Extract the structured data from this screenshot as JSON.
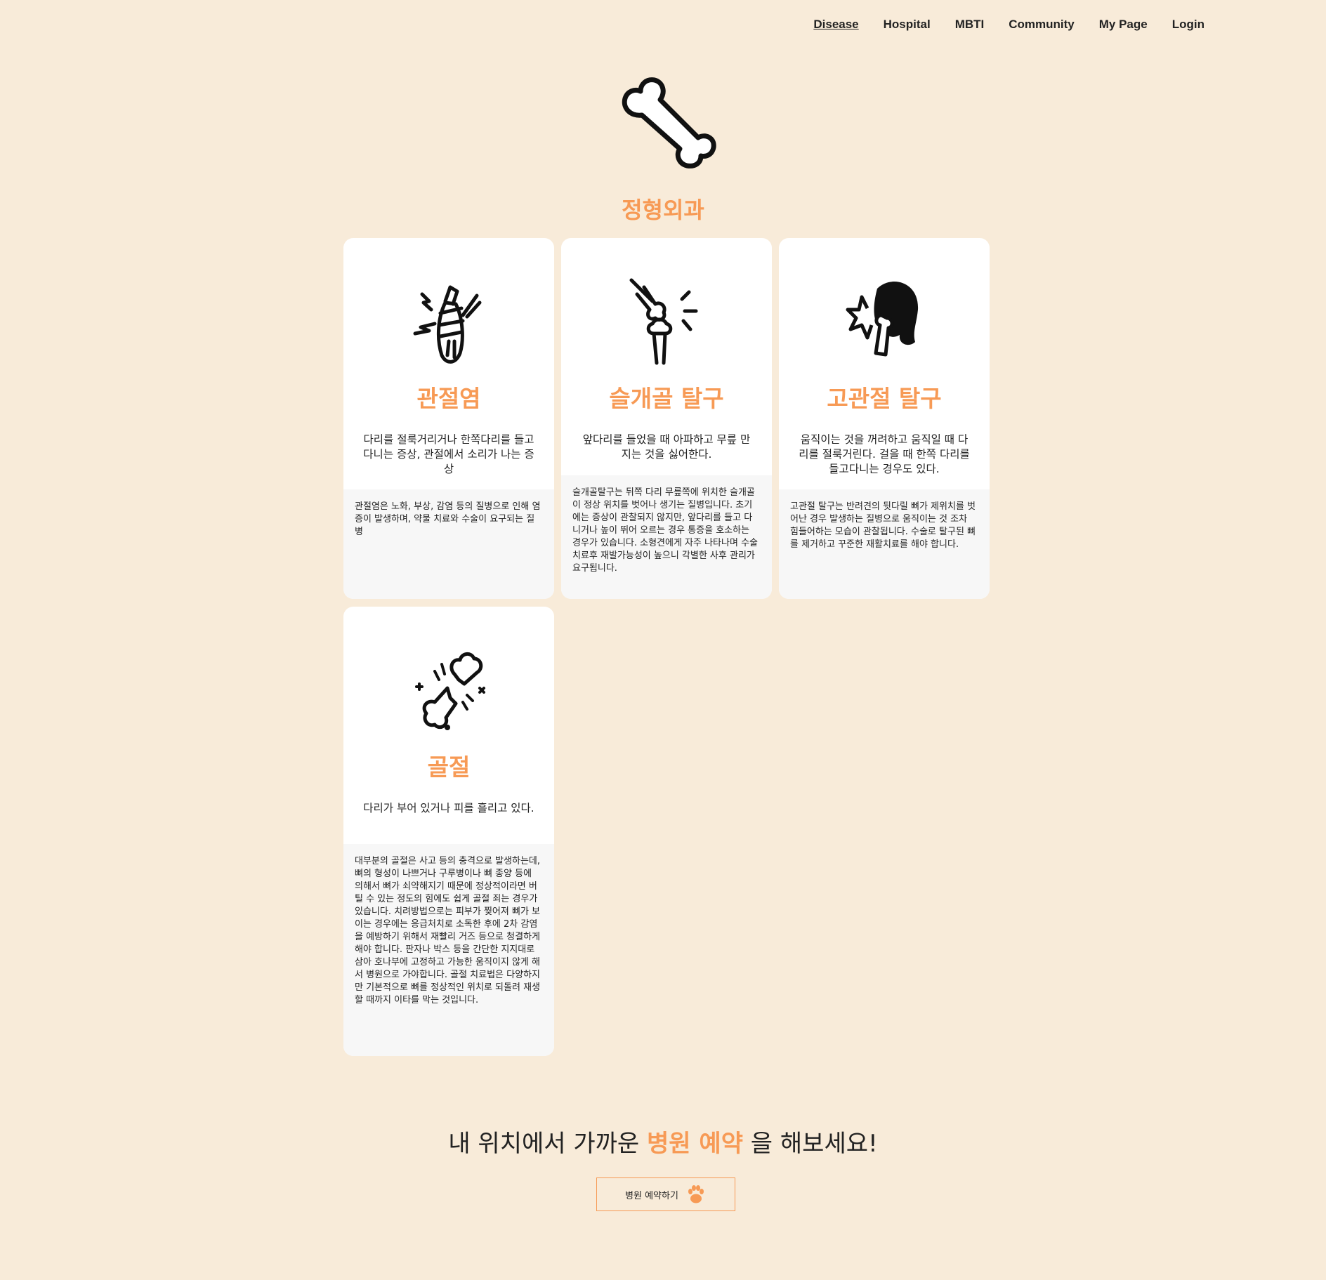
{
  "nav": {
    "items": [
      {
        "label": "Disease",
        "active": true
      },
      {
        "label": "Hospital",
        "active": false
      },
      {
        "label": "MBTI",
        "active": false
      },
      {
        "label": "Community",
        "active": false
      },
      {
        "label": "My Page",
        "active": false
      },
      {
        "label": "Login",
        "active": false
      }
    ]
  },
  "hero": {
    "icon": "bone-icon"
  },
  "section": {
    "title": "정형외과"
  },
  "cards": [
    {
      "icon": "bandaged-leg-icon",
      "title": "관절염",
      "symptom": "다리를 절룩거리거나 한쪽다리를 들고다니는 증상, 관절에서 소리가 나는 증상",
      "detail": "관절염은 노화, 부상, 감염 등의 질병으로 인해 염증이 발생하며, 약물 치료와 수술이 요구되는 질병"
    },
    {
      "icon": "knee-joint-icon",
      "title": "슬개골 탈구",
      "symptom": "앞다리를 들었을 때 아파하고 무릎 만지는 것을 싫어한다.",
      "detail": "슬개골탈구는 뒤쪽 다리 무릎쪽에 위치한 슬개골이 정상 위치를 벗어나 생기는 질병입니다. 초기에는 증상이 관찰되지 않지만, 앞다리를 들고 다니거나 높이 뛰어 오르는 경우 통증을 호소하는 경우가 있습니다. 소형견에게 자주 나타나며 수술 치료후 재발가능성이 높으니 각별한 사후 관리가 요구됩니다."
    },
    {
      "icon": "hip-joint-icon",
      "title": "고관절 탈구",
      "symptom": "움직이는 것을 꺼려하고 움직일 때 다리를 절룩거린다. 걸을 때 한쪽 다리를 들고다니는 경우도 있다.",
      "detail": "고관절 탈구는 반려견의 뒷다릴 뼈가 제위치를 벗어난 경우 발생하는 질병으로 움직이는 것 조차 힘들어하는 모습이 관찰됩니다. 수술로 탈구된 뼈를 제거하고 꾸준한 재활치료를 해야 합니다."
    },
    {
      "icon": "broken-bone-icon",
      "title": "골절",
      "symptom": "다리가 부어 있거나 피를 흘리고 있다.",
      "detail": "대부분의 골절은 사고 등의 충격으로 발생하는데, 뼈의 형성이 나쁘거나 구루병이나 뼈 종양 등에 의해서 뼈가 쇠약해지기 때문에 정상적이라면 버틸 수 있는 정도의 힘에도 쉽게 골절 죄는 경우가 있습니다. 치려방법으로는 피부가 찢어져 뼈가 보이는 경우에는 응급처치로 소독한 후에 2차 감염을 예방하기 위해서 재빨리 거즈 등으로 청결하게 해야 합니다. 판자나 박스 등을 간단한 지지대로 삼아 호나부에 고정하고 가능한 움직이지 않게 해서 병원으로 가야합니다. 골절 치료법은 다양하지만 기본적으로 뼈를 정상적인 위치로 되돌려 재생할 때까지 이타를 막는 것입니다."
    }
  ],
  "cta": {
    "text_before": "내 위치에서 가까운",
    "highlight": "병원 예약",
    "text_after": "을 해보세요!",
    "button_label": "병원 예약하기",
    "button_icon": "paw-icon"
  },
  "colors": {
    "accent": "#f79a55",
    "background": "#f8ebd9"
  }
}
